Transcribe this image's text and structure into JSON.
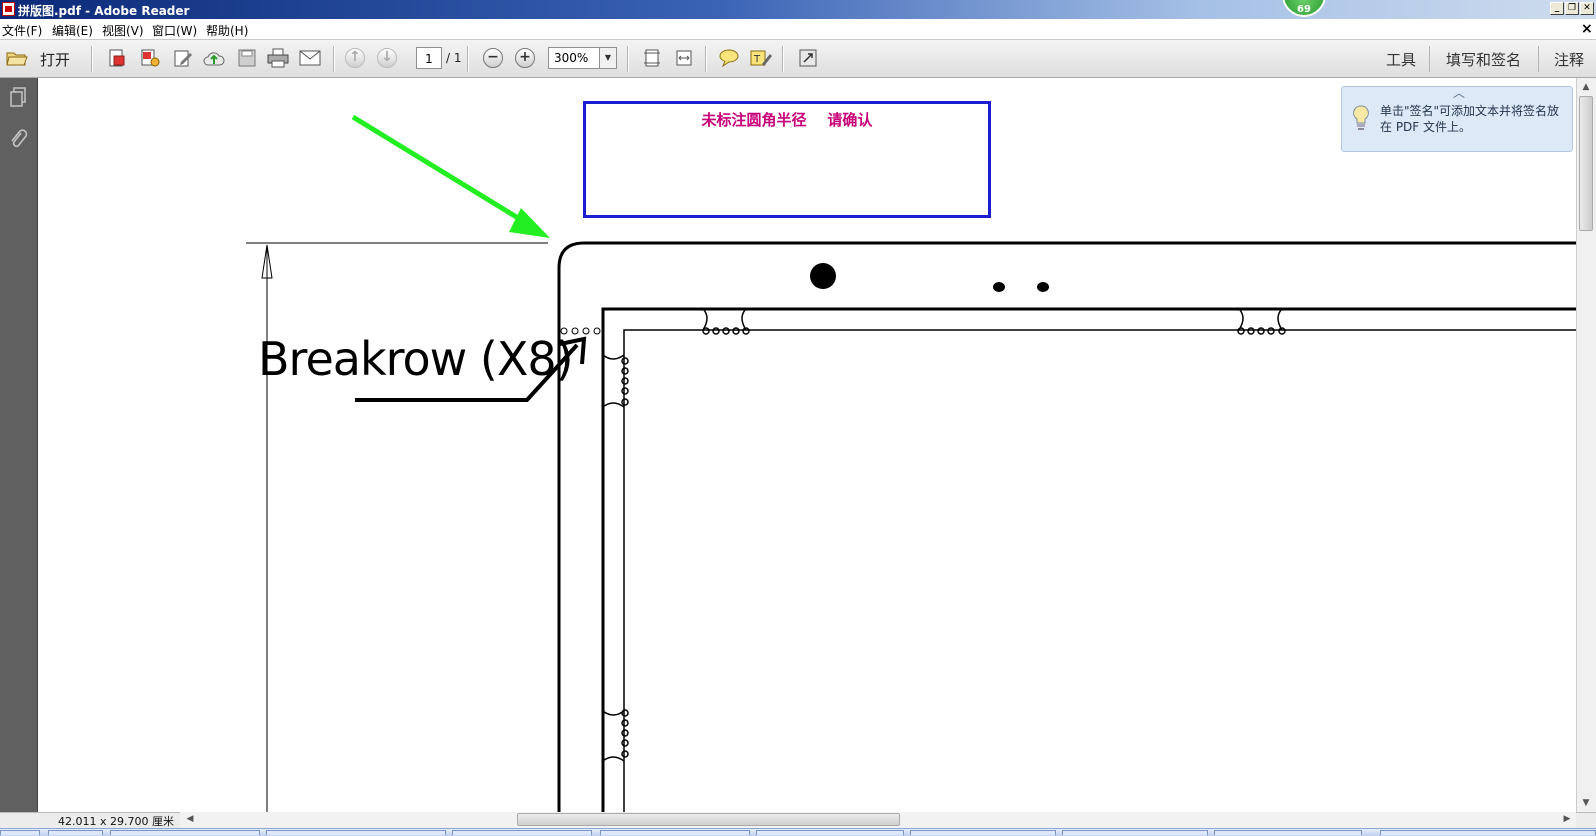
{
  "window": {
    "title": "拼版图.pdf - Adobe Reader",
    "badge": "69",
    "minimize_glyph": "_",
    "restore_glyph": "❐",
    "close_glyph": "✕",
    "doc_close_glyph": "×"
  },
  "menu": {
    "items": [
      "文件(F)",
      "编辑(E)",
      "视图(V)",
      "窗口(W)",
      "帮助(H)"
    ]
  },
  "toolbar": {
    "open_label": "打开",
    "page_current": "1",
    "page_total": "/ 1",
    "zoom": "300%",
    "right_tabs": [
      "工具",
      "填写和签名",
      "注释"
    ],
    "icons": [
      "folder-open-icon",
      "create-pdf-icon",
      "export-pdf-icon",
      "edit-icon",
      "upload-cloud-icon",
      "save-icon",
      "print-icon",
      "email-icon",
      "page-up-icon",
      "page-down-icon",
      "zoom-out-icon",
      "zoom-in-icon",
      "fit-page-icon",
      "fit-width-icon",
      "comment-icon",
      "highlight-icon",
      "fullscreen-icon"
    ]
  },
  "document": {
    "callout_text": "未标注圆角半径    请确认",
    "label_text": "Breakrow (X8)",
    "colors": {
      "callout_border": "#1c1cd0",
      "callout_text": "#c8007a",
      "green_arrow": "#22ee22"
    }
  },
  "tip": {
    "text": "单击\"签名\"可添加文本并将签名放在 PDF 文件上。"
  },
  "status": {
    "page_size": "42.011 x 29.700 厘米"
  }
}
